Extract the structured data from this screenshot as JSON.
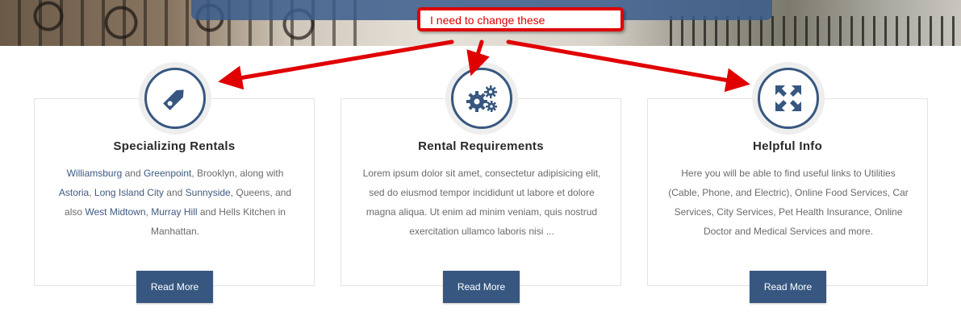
{
  "annotation": {
    "callout_text": "I need to change these",
    "color": "#e00000"
  },
  "colors": {
    "accent": "#375780",
    "link": "#3e5a82",
    "body_text": "#6b6b6b",
    "heading": "#2a2a2a",
    "card_border": "#e3e3e3"
  },
  "cards": [
    {
      "icon": "tag-icon",
      "title": "Specializing Rentals",
      "body_parts": [
        {
          "text": "Williamsburg",
          "link": true
        },
        {
          "text": " and ",
          "link": false
        },
        {
          "text": "Greenpoint",
          "link": true
        },
        {
          "text": ", Brooklyn, along with ",
          "link": false
        },
        {
          "text": "Astoria",
          "link": true
        },
        {
          "text": ", ",
          "link": false
        },
        {
          "text": "Long Island City",
          "link": true
        },
        {
          "text": " and ",
          "link": false
        },
        {
          "text": "Sunnyside",
          "link": true
        },
        {
          "text": ", Queens, and also ",
          "link": false
        },
        {
          "text": "West Midtown",
          "link": true
        },
        {
          "text": ", ",
          "link": false
        },
        {
          "text": "Murray Hill",
          "link": true
        },
        {
          "text": " and Hells Kitchen in Manhattan.",
          "link": false
        }
      ],
      "button": "Read More"
    },
    {
      "icon": "gears-icon",
      "title": "Rental Requirements",
      "body": "Lorem ipsum dolor sit amet, consectetur adipisicing elit, sed do eiusmod tempor incididunt ut labore et dolore magna aliqua. Ut enim ad minim veniam, quis nostrud exercitation ullamco laboris nisi ...",
      "button": "Read More"
    },
    {
      "icon": "expand-arrows-icon",
      "title": "Helpful Info",
      "body": "Here you will be able to find useful links to Utilities (Cable, Phone, and Electric), Online Food Services, Car Services, City Services, Pet Health Insurance, Online Doctor and Medical Services and more.",
      "button": "Read More"
    }
  ]
}
